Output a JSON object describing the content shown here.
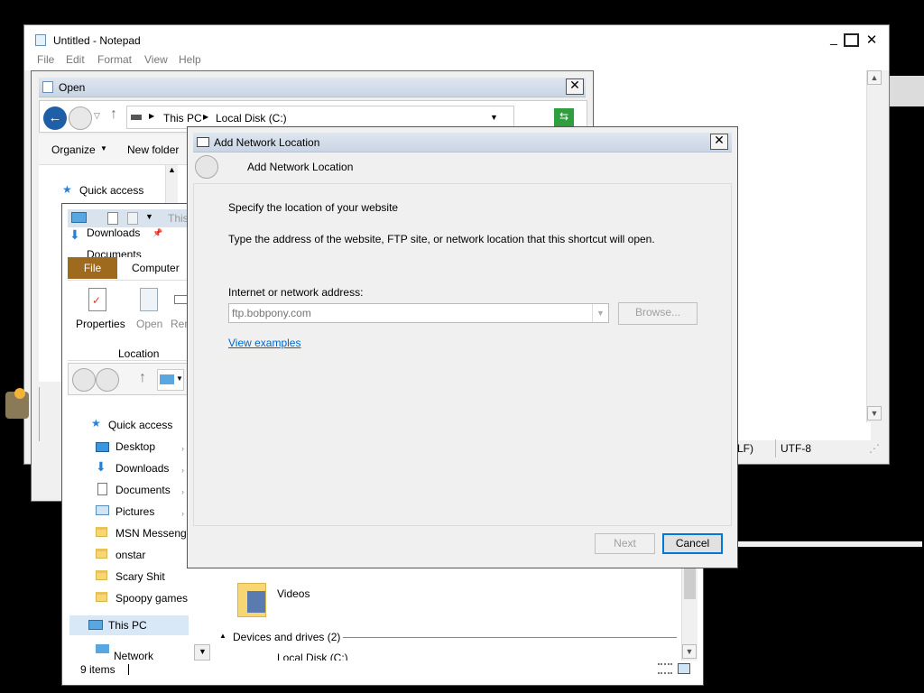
{
  "notepad": {
    "title": "Untitled - Notepad",
    "menu": [
      "File",
      "Edit",
      "Format",
      "View",
      "Help"
    ],
    "status_eol_fragment": "LF)",
    "status_encoding": "UTF-8"
  },
  "open_dialog": {
    "title": "Open",
    "address_segments": [
      "This PC",
      "Local Disk (C:)"
    ],
    "toolbar": {
      "organize": "Organize",
      "new_folder": "New folder"
    },
    "nav": [
      "Quick access",
      "Downloads",
      "Documents"
    ]
  },
  "explorer": {
    "qat_fragment": "This",
    "ribbon_tabs": [
      "File",
      "Computer"
    ],
    "ribbon_buttons": [
      "Properties",
      "Open",
      "Rena"
    ],
    "ribbon_group": "Location",
    "nav": {
      "quick_access": "Quick access",
      "items": [
        "Desktop",
        "Downloads",
        "Documents",
        "Pictures",
        "MSN Messeng",
        "onstar",
        "Scary Shit",
        "Spoopy games"
      ],
      "this_pc": "This PC",
      "network": "Network"
    },
    "content": {
      "videos": "Videos",
      "devices_header": "Devices and drives (2)",
      "local_disk": "Local Disk (C:)"
    },
    "status_items": "9 items"
  },
  "add_network_location": {
    "title": "Add Network Location",
    "header": "Add Network Location",
    "heading": "Specify the location of your website",
    "description": "Type the address of the website, FTP site, or network location that this shortcut will open.",
    "address_label": "Internet or network address:",
    "address_placeholder": "ftp.bobpony.com",
    "browse_label": "Browse...",
    "examples_link": "View examples",
    "next_label": "Next",
    "cancel_label": "Cancel"
  },
  "colors": {
    "ribbon_file_tab": "#9e6a1e",
    "link": "#0066cc",
    "dialog_bg": "#f0f0f0",
    "titlebar": "#c9d5e4"
  }
}
